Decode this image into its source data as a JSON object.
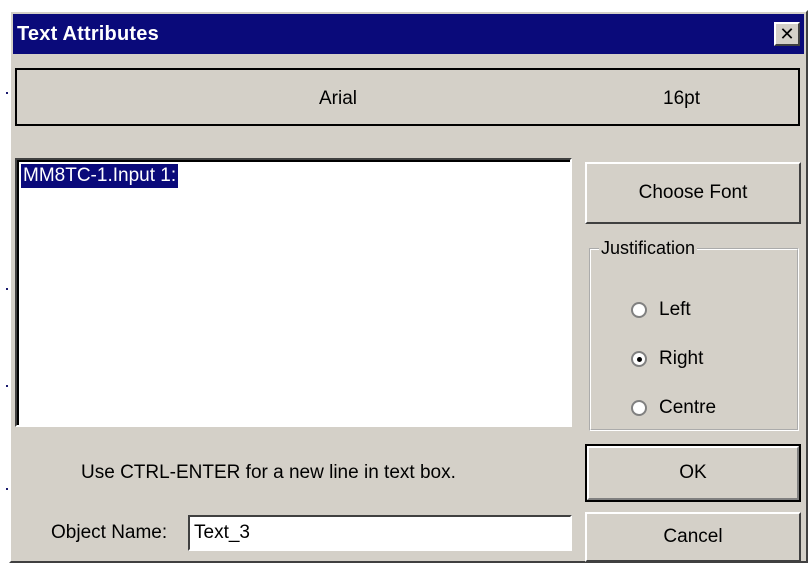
{
  "window": {
    "title": "Text Attributes",
    "close_symbol": "✕"
  },
  "font_info": {
    "name": "Arial",
    "size": "16pt"
  },
  "text_box": {
    "value": "MM8TC-1.Input 1:"
  },
  "buttons": {
    "choose_font": "Choose Font",
    "ok": "OK",
    "cancel": "Cancel"
  },
  "justification": {
    "label": "Justification",
    "options": [
      {
        "label": "Left",
        "checked": false
      },
      {
        "label": "Right",
        "checked": true
      },
      {
        "label": "Centre",
        "checked": false
      }
    ]
  },
  "hint": "Use CTRL-ENTER for a new line in text box.",
  "object_name": {
    "label": "Object Name:",
    "value": "Text_3"
  },
  "colors": {
    "title_bar": "#0a0a7a",
    "dialog_face": "#d4d0c8",
    "selection": "#0a0a7a"
  }
}
